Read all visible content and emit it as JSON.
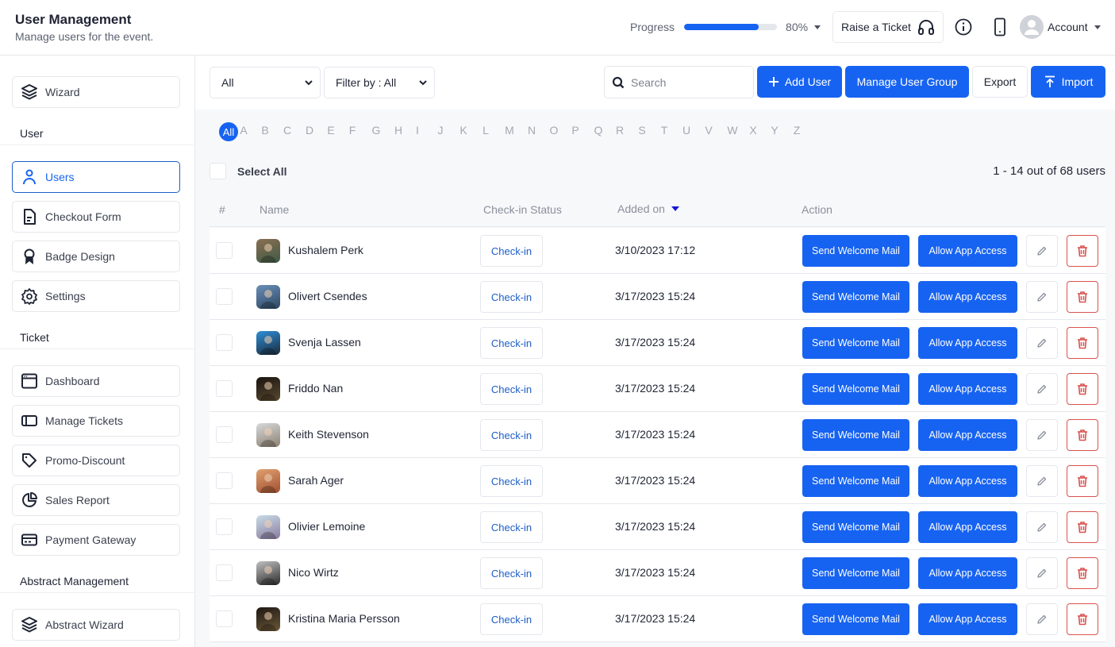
{
  "header": {
    "title": "User Management",
    "subtitle": "Manage users for the event.",
    "progress_label": "Progress",
    "progress_percent": 80,
    "progress_text": "80%",
    "raise_ticket_label": "Raise a Ticket",
    "account_label": "Account"
  },
  "colors": {
    "primary": "#1763f1",
    "danger": "#d9534f",
    "active_border": "#1d5ec7"
  },
  "sidebar": {
    "top_items": [
      {
        "label": "Wizard",
        "icon": "layers-icon"
      }
    ],
    "sections": [
      {
        "title": "User",
        "items": [
          {
            "label": "Users",
            "icon": "user-icon",
            "active": true
          },
          {
            "label": "Checkout Form",
            "icon": "document-icon"
          },
          {
            "label": "Badge Design",
            "icon": "badge-icon"
          },
          {
            "label": "Settings",
            "icon": "gear-icon"
          }
        ]
      },
      {
        "title": "Ticket",
        "items": [
          {
            "label": "Dashboard",
            "icon": "browser-icon"
          },
          {
            "label": "Manage Tickets",
            "icon": "panel-icon"
          },
          {
            "label": "Promo-Discount",
            "icon": "tag-icon"
          },
          {
            "label": "Sales Report",
            "icon": "pie-chart-icon"
          },
          {
            "label": "Payment Gateway",
            "icon": "credit-card-icon"
          }
        ]
      },
      {
        "title": "Abstract Management",
        "items": [
          {
            "label": "Abstract Wizard",
            "icon": "layers-icon"
          }
        ]
      }
    ]
  },
  "toolbar": {
    "group_select": "All",
    "filter_select": "Filter by : All",
    "search_placeholder": "Search",
    "search_value": "",
    "add_user_label": "Add User",
    "manage_group_label": "Manage User Group",
    "export_label": "Export",
    "import_label": "Import"
  },
  "alphabet": [
    "All",
    "A",
    "B",
    "C",
    "D",
    "E",
    "F",
    "G",
    "H",
    "I",
    "J",
    "K",
    "L",
    "M",
    "N",
    "O",
    "P",
    "Q",
    "R",
    "S",
    "T",
    "U",
    "V",
    "W",
    "X",
    "Y",
    "Z"
  ],
  "alphabet_selected": "All",
  "list": {
    "select_all_label": "Select All",
    "count_text": "1 - 14 out of 68 users",
    "columns": {
      "index": "#",
      "name": "Name",
      "checkin": "Check-in Status",
      "added": "Added on",
      "action": "Action"
    },
    "checkin_label": "Check-in",
    "welcome_label": "Send Welcome Mail",
    "app_access_label": "Allow App Access",
    "users": [
      {
        "name": "Kushalem Perk",
        "added_on": "3/10/2023 17:12"
      },
      {
        "name": "Olivert Csendes",
        "added_on": "3/17/2023 15:24"
      },
      {
        "name": "Svenja Lassen",
        "added_on": "3/17/2023 15:24"
      },
      {
        "name": "Friddo Nan",
        "added_on": "3/17/2023 15:24"
      },
      {
        "name": "Keith Stevenson",
        "added_on": "3/17/2023 15:24"
      },
      {
        "name": "Sarah Ager",
        "added_on": "3/17/2023 15:24"
      },
      {
        "name": "Olivier Lemoine",
        "added_on": "3/17/2023 15:24"
      },
      {
        "name": "Nico Wirtz",
        "added_on": "3/17/2023 15:24"
      },
      {
        "name": "Kristina Maria Persson",
        "added_on": "3/17/2023 15:24"
      }
    ]
  }
}
